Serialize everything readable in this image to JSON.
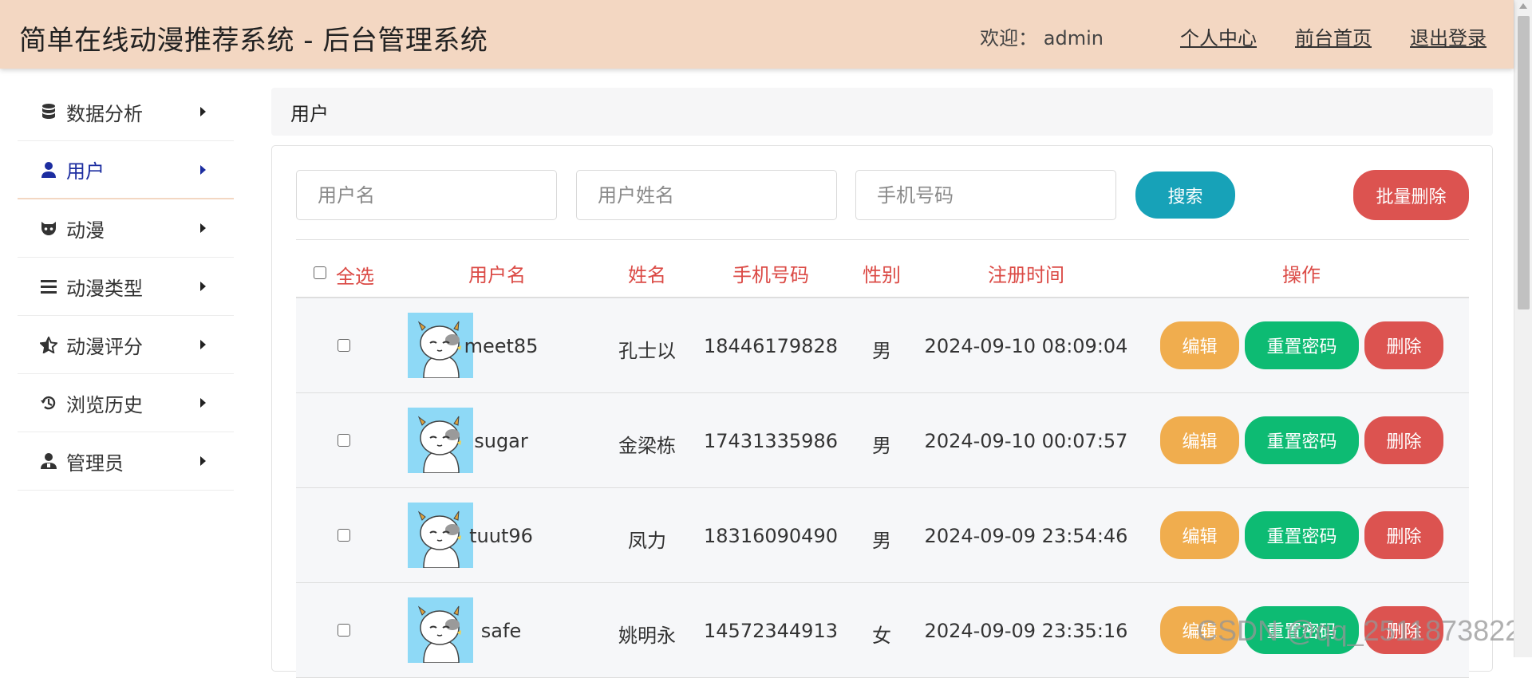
{
  "header": {
    "title": "简单在线动漫推荐系统 - 后台管理系统",
    "welcome": "欢迎：  admin",
    "links": {
      "profile": "个人中心",
      "home": "前台首页",
      "logout": "退出登录"
    },
    "background": "#f3d7c2"
  },
  "sidebar": {
    "items": [
      {
        "label": "数据分析",
        "icon": "database-icon"
      },
      {
        "label": "用户",
        "icon": "user-icon",
        "active": true
      },
      {
        "label": "动漫",
        "icon": "github-cat-icon"
      },
      {
        "label": "动漫类型",
        "icon": "list-icon"
      },
      {
        "label": "动漫评分",
        "icon": "star-half-icon"
      },
      {
        "label": "浏览历史",
        "icon": "history-icon"
      },
      {
        "label": "管理员",
        "icon": "admin-user-icon"
      }
    ]
  },
  "breadcrumb": {
    "title": "用户"
  },
  "search": {
    "username_placeholder": "用户名",
    "name_placeholder": "用户姓名",
    "phone_placeholder": "手机号码",
    "search_label": "搜索",
    "batch_delete_label": "批量删除"
  },
  "table": {
    "headers": {
      "select_all": "全选",
      "username": "用户名",
      "name": "姓名",
      "phone": "手机号码",
      "gender": "性别",
      "register_time": "注册时间",
      "actions": "操作"
    },
    "rows": [
      {
        "username": "meet85",
        "name": "孔士以",
        "phone": "18446179828",
        "gender": "男",
        "register_time": "2024-09-10 08:09:04"
      },
      {
        "username": "sugar",
        "name": "金梁栋",
        "phone": "17431335986",
        "gender": "男",
        "register_time": "2024-09-10 00:07:57"
      },
      {
        "username": "tuut96",
        "name": "凤力",
        "phone": "18316090490",
        "gender": "男",
        "register_time": "2024-09-09 23:54:46"
      },
      {
        "username": "safe",
        "name": "姚明永",
        "phone": "14572344913",
        "gender": "女",
        "register_time": "2024-09-09 23:35:16"
      }
    ],
    "row_actions": {
      "edit": "编辑",
      "reset": "重置密码",
      "delete": "删除"
    }
  },
  "colors": {
    "header_accent": "#db4a45",
    "search_button": "#17a2b8",
    "danger": "#dc5350",
    "warning": "#f0ad4e",
    "success": "#0dbb73"
  },
  "watermark": "CSDN @qq_2511873822"
}
